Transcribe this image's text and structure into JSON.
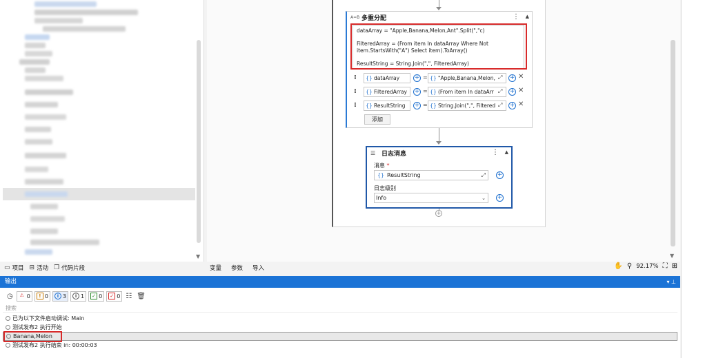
{
  "colors": {
    "accent": "#1b73d6",
    "highlight_red": "#d82a2a",
    "selected_border": "#2058a8"
  },
  "assign": {
    "title": "多重分配",
    "icon": "A=B",
    "code_lines": [
      "dataArray = \"Apple,Banana,Melon,Ant\".Split(\",\"c)",
      "",
      "FilteredArray = (From item In dataArray Where Not",
      "item.StartsWith(\"A\") Select item).ToArray()",
      "",
      "ResultString = String.Join(\",\", FilteredArray)"
    ],
    "rows": [
      {
        "left": "dataArray",
        "right": "\"Apple,Banana,Melon,"
      },
      {
        "left": "FilteredArray",
        "right": "(From item In dataArr"
      },
      {
        "left": "ResultString",
        "right": "String.Join(\",\", Filtered"
      }
    ],
    "brace": "{}",
    "equals": "=",
    "add_label": "添加"
  },
  "log": {
    "title": "日志消息",
    "message_label": "消息",
    "required_mark": "*",
    "message_value": "ResultString",
    "level_label": "日志级别",
    "level_value": "Info"
  },
  "left_tabs": [
    {
      "label": "项目",
      "icon": "folder-icon"
    },
    {
      "label": "活动",
      "icon": "activity-icon"
    },
    {
      "label": "代码片段",
      "icon": "snippet-icon"
    }
  ],
  "canvas_tabs": [
    "变量",
    "参数",
    "导入"
  ],
  "zoom": "92.17%",
  "output": {
    "title": "输出",
    "search_placeholder": "搜索",
    "counts": {
      "error": "0",
      "warning": "0",
      "info": "3",
      "trace": "1",
      "success": "0",
      "fail": "0"
    },
    "lines": [
      "已为以下文件启动调试: Main",
      "测试发布2 执行开始",
      "Banana,Melon",
      "测试发布2 执行结束 in: 00:00:03"
    ]
  }
}
